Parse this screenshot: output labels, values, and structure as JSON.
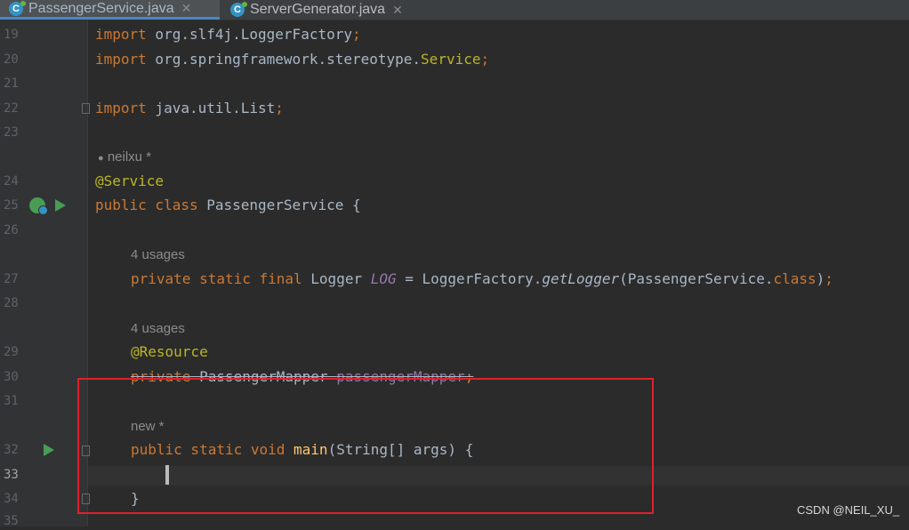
{
  "tabs": [
    {
      "label": "PassengerService.java",
      "icon": "java-class-icon",
      "active": true
    },
    {
      "label": "ServerGenerator.java",
      "icon": "java-class-icon",
      "active": false
    }
  ],
  "close_glyph": "✕",
  "class_icon_letter": "C",
  "line_numbers": [
    "19",
    "20",
    "21",
    "22",
    "23",
    "24",
    "25",
    "26",
    "27",
    "28",
    "29",
    "30",
    "31",
    "32",
    "33",
    "34",
    "35"
  ],
  "hints": {
    "author": "neilxu *",
    "log_usages": "4 usages",
    "mapper_usages": "4 usages",
    "main_author": "new *"
  },
  "code": {
    "l19": {
      "kw": "import",
      "rest": " org.slf4j.LoggerFactory",
      "semi": ";"
    },
    "l20": {
      "kw": "import",
      "rest": " org.springframework.stereotype.",
      "ann": "Service",
      "semi": ";"
    },
    "l22": {
      "kw": "import",
      "rest": " java.util.List",
      "semi": ";"
    },
    "l24": {
      "ann": "@Service"
    },
    "l25": {
      "kw": "public class",
      "rest": " PassengerService {"
    },
    "l27": {
      "kw": "private static final",
      "t1": " Logger ",
      "fld": "LOG",
      "t2": " = LoggerFactory.",
      "method": "getLogger",
      "t3": "(PassengerService.",
      "kw2": "class",
      "t4": ")",
      "semi": ";"
    },
    "l29": {
      "ann": "@Resource"
    },
    "l30": {
      "kw": "private",
      "t1": " PassengerMapper ",
      "fld": "passengerMapper",
      "semi": ";"
    },
    "l32": {
      "kw": "public static void",
      "sp": " ",
      "fn": "main",
      "rest": "(String[] args) {"
    },
    "l34": {
      "rest": "}"
    }
  },
  "accent_colors": {
    "run": "#499c54",
    "highlight_box": "#e0202a",
    "keyword": "#cc7832",
    "annotation": "#bbb529"
  },
  "watermark": "CSDN @NEIL_XU_"
}
